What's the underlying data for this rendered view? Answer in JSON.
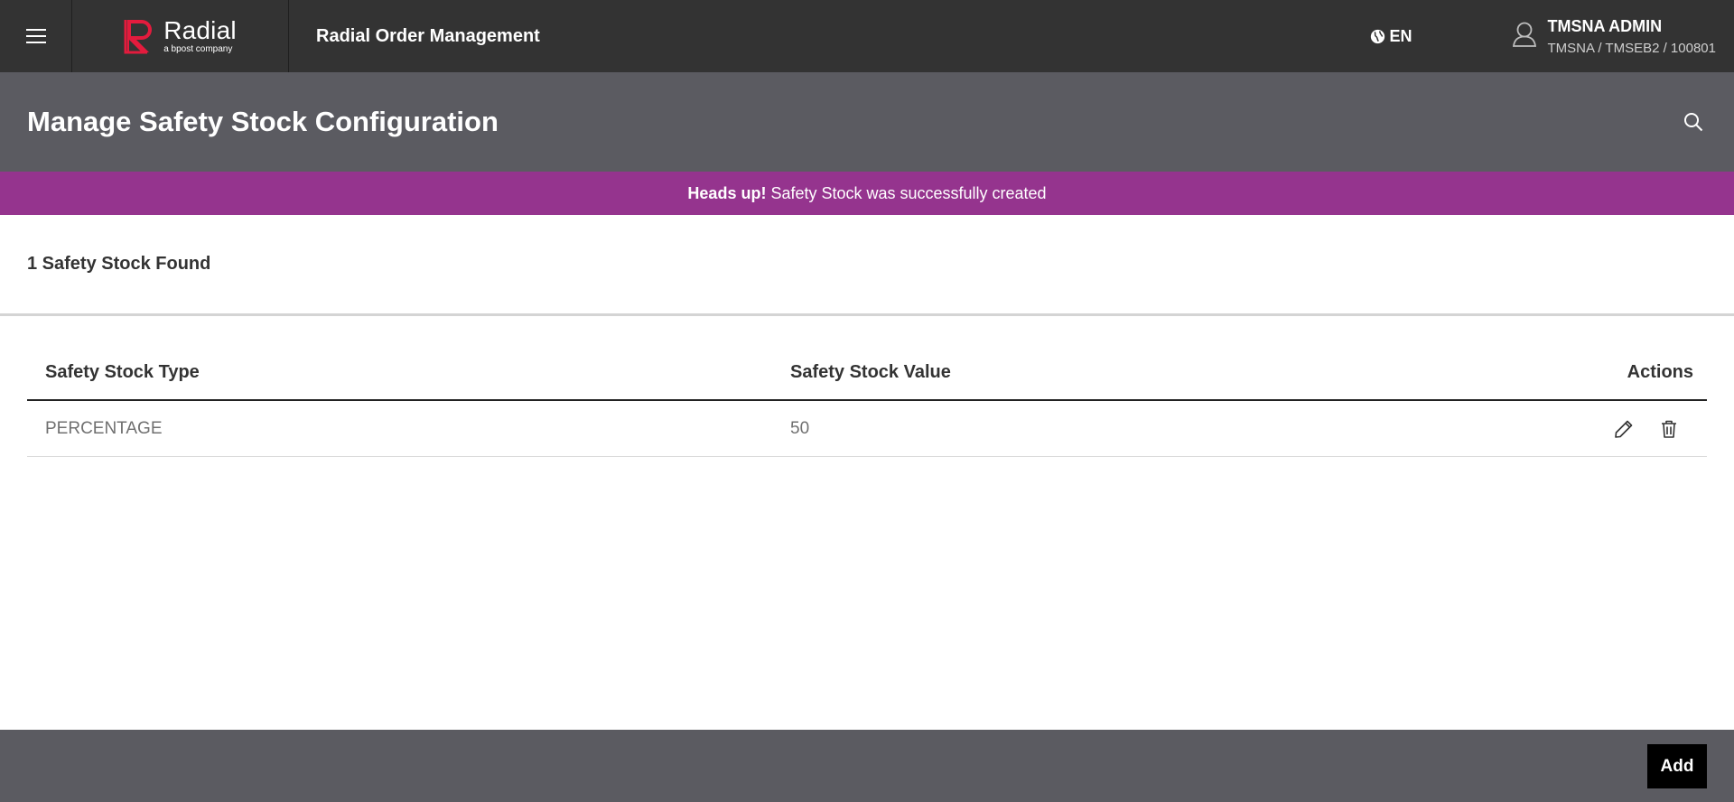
{
  "header": {
    "logo_name": "Radial",
    "logo_tagline": "a bpost company",
    "app_title": "Radial Order Management",
    "language": "EN",
    "user_name": "TMSNA ADMIN",
    "user_org": "TMSNA / TMSEB2 / 100801",
    "brand_color": "#e31b3d"
  },
  "page": {
    "title": "Manage Safety Stock Configuration"
  },
  "alert": {
    "strong": "Heads up!",
    "message": "Safety Stock was successfully created",
    "color": "#95348e"
  },
  "results": {
    "count_text": "1 Safety Stock Found"
  },
  "table": {
    "columns": [
      "Safety Stock Type",
      "Safety Stock Value",
      "Actions"
    ],
    "rows": [
      {
        "type": "PERCENTAGE",
        "value": "50"
      }
    ]
  },
  "footer": {
    "add_label": "Add"
  },
  "icons": [
    "menu-icon",
    "radial-logo-icon",
    "globe-icon",
    "user-icon",
    "search-icon",
    "edit-icon",
    "delete-icon"
  ]
}
